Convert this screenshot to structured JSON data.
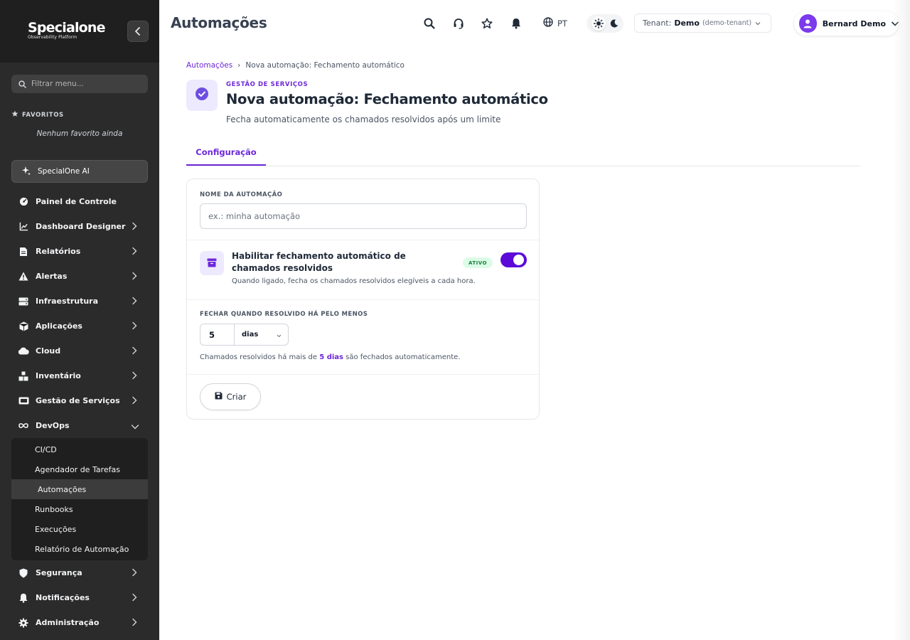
{
  "colors": {
    "accent": "#6d28d9",
    "toggle_on": "#5b0ad8",
    "sidebar_bg": "#2b2b2b",
    "badge_bg": "#dcfce7",
    "badge_text": "#15803d"
  },
  "brand": {
    "name": "Specialone",
    "tagline": "Observability Platform"
  },
  "sidebar": {
    "filter_placeholder": "Filtrar menu...",
    "favorites_title": "FAVORITOS",
    "favorites_empty": "Nenhum favorito ainda",
    "ai_label": "SpecialOne AI",
    "items": [
      {
        "label": "Painel de Controle",
        "icon": "dashboard-icon"
      },
      {
        "label": "Dashboard Designer",
        "icon": "chart-line-icon"
      },
      {
        "label": "Relatórios",
        "icon": "file-icon"
      },
      {
        "label": "Alertas",
        "icon": "warning-icon"
      },
      {
        "label": "Infraestrutura",
        "icon": "server-icon"
      },
      {
        "label": "Aplicações",
        "icon": "box-icon"
      },
      {
        "label": "Cloud",
        "icon": "cloud-icon"
      },
      {
        "label": "Inventário",
        "icon": "boxes-icon"
      },
      {
        "label": "Gestão de Serviços",
        "icon": "ticket-icon"
      },
      {
        "label": "DevOps",
        "icon": "infinity-icon"
      },
      {
        "label": "Segurança",
        "icon": "shield-icon"
      },
      {
        "label": "Notificações",
        "icon": "bell-icon"
      },
      {
        "label": "Administração",
        "icon": "gear-icon"
      }
    ],
    "devops_sub": [
      "CI/CD",
      "Agendador de Tarefas",
      "Automações",
      "Runbooks",
      "Execuções",
      "Relatório de Automação"
    ]
  },
  "topbar": {
    "title": "Automações",
    "lang": "PT",
    "tenant_label": "Tenant:",
    "tenant_name": "Demo",
    "tenant_id": "(demo-tenant)",
    "user_name": "Bernard Demo"
  },
  "main": {
    "breadcrumb_root": "Automações",
    "breadcrumb_sep": "›",
    "breadcrumb_current": "Nova automação: Fechamento automático",
    "eyebrow": "GESTÃO DE SERVIÇOS",
    "title": "Nova automação: Fechamento automático",
    "description": "Fecha automaticamente os chamados resolvidos após um limite",
    "tab": "Configuração"
  },
  "form": {
    "name_label": "NOME DA AUTOMAÇÃO",
    "name_placeholder": "ex.: minha automação",
    "name_value": "",
    "toggle_title": "Habilitar fechamento automático de chamados resolvidos",
    "toggle_desc": "Quando ligado, fecha os chamados resolvidos elegíveis a cada hora.",
    "toggle_badge": "ATIVO",
    "toggle_on": true,
    "duration_label": "FECHAR QUANDO RESOLVIDO HÁ PELO MENOS",
    "duration_value": "5",
    "duration_unit": "dias",
    "hint_prefix": "Chamados resolvidos há mais de",
    "hint_value": "5 dias",
    "hint_suffix": "são fechados automaticamente.",
    "create_label": "Criar"
  }
}
